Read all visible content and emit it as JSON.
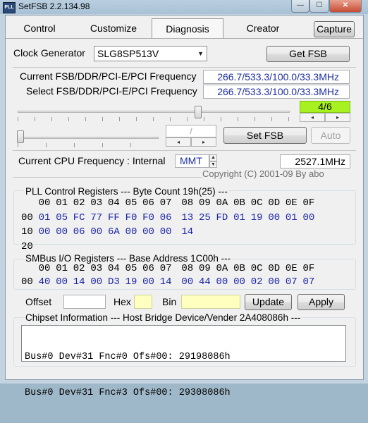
{
  "window": {
    "title": "SetFSB 2.2.134.98",
    "icon_text": "PLL",
    "minimize": "—",
    "maximize": "☐",
    "close": "✕"
  },
  "tabs": [
    {
      "label": "Control"
    },
    {
      "label": "Customize"
    },
    {
      "label": "Diagnosis"
    },
    {
      "label": "Creator"
    }
  ],
  "capture_label": "Capture",
  "clock_generator": {
    "label": "Clock Generator",
    "value": "SLG8SP513V",
    "get_fsb_label": "Get FSB"
  },
  "frequency": {
    "current_label": "Current FSB/DDR/PCI-E/PCI Frequency",
    "current_value": "266.7/533.3/100.0/33.3MHz",
    "select_label": "Select FSB/DDR/PCI-E/PCI Frequency",
    "select_value": "266.7/533.3/100.0/33.3MHz",
    "ratio": "4/6",
    "slider_level": 0.62,
    "divider_field": "/",
    "set_fsb_label": "Set FSB",
    "auto_label": "Auto"
  },
  "cpu": {
    "label": "Current CPU Frequency : Internal",
    "source": "MMT",
    "value": "2527.1MHz"
  },
  "copyright": "Copyright (C) 2001-09 By abo",
  "pll": {
    "header": "PLL Control Registers  --- Byte Count 19h(25) ---",
    "columns": [
      "00",
      "01",
      "02",
      "03",
      "04",
      "05",
      "06",
      "07",
      "08",
      "09",
      "0A",
      "0B",
      "0C",
      "0D",
      "0E",
      "0F"
    ],
    "rows": [
      {
        "addr": "00",
        "values": [
          "01",
          "05",
          "FC",
          "77",
          "FF",
          "F0",
          "F0",
          "06",
          "13",
          "25",
          "FD",
          "01",
          "19",
          "00",
          "01",
          "00"
        ]
      },
      {
        "addr": "10",
        "values": [
          "00",
          "00",
          "06",
          "00",
          "6A",
          "00",
          "00",
          "00",
          "14",
          "",
          "",
          "",
          "",
          "",
          "",
          ""
        ]
      },
      {
        "addr": "20",
        "values": [
          "",
          "",
          "",
          "",
          "",
          "",
          "",
          "",
          "",
          "",
          "",
          "",
          "",
          "",
          "",
          ""
        ]
      }
    ]
  },
  "smbus": {
    "header": "SMBus I/O Registers  --- Base Address 1C00h ---",
    "columns": [
      "00",
      "01",
      "02",
      "03",
      "04",
      "05",
      "06",
      "07",
      "08",
      "09",
      "0A",
      "0B",
      "0C",
      "0D",
      "0E",
      "0F"
    ],
    "rows": [
      {
        "addr": "00",
        "values": [
          "40",
          "00",
          "14",
          "00",
          "D3",
          "19",
          "00",
          "14",
          "00",
          "44",
          "00",
          "00",
          "02",
          "00",
          "07",
          "07"
        ]
      }
    ]
  },
  "io": {
    "offset_label": "Offset",
    "hex_label": "Hex",
    "bin_label": "Bin",
    "update_label": "Update",
    "apply_label": "Apply"
  },
  "chipset": {
    "header": "Chipset Information  --- Host Bridge Device/Vender 2A408086h ---",
    "lines": [
      "Bus#0 Dev#31 Fnc#0 Ofs#00: 29198086h",
      "Bus#0 Dev#31 Fnc#3 Ofs#00: 29308086h"
    ]
  }
}
